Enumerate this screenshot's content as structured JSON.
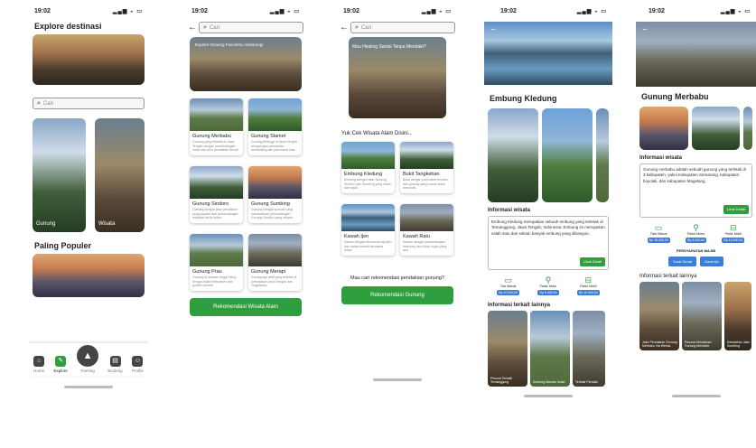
{
  "status": {
    "time": "19:02",
    "icons": "signal-wifi-battery"
  },
  "s1": {
    "title": "Explore destinasi",
    "search_placeholder": "Cari",
    "card1_label": "Gunung",
    "card2_label": "Wisata",
    "popular_title": "Paling Populer",
    "nav": [
      {
        "label": "Home",
        "icon": "home-icon"
      },
      {
        "label": "Explore",
        "icon": "explore-icon"
      },
      {
        "label": "Parking",
        "icon": "navigate-icon"
      },
      {
        "label": "Booking",
        "icon": "booking-icon"
      },
      {
        "label": "Profile",
        "icon": "profile-icon"
      }
    ]
  },
  "s2": {
    "search_placeholder": "Cari",
    "banner": "Explore Gunung Favoritmu Sekarang!",
    "cards": [
      {
        "name": "Gunung Merbabu",
        "desc": "Gunung yang terletak di Jawa Tengah dengan pemandangan indah dan jalur pendakian favorit."
      },
      {
        "name": "Gunung Slamet",
        "desc": "Gunung tertinggi di Jawa Tengah dengan jalur pendakian menantang dan panorama luas."
      },
      {
        "name": "Gunung Sindoro",
        "desc": "Gunung dengan jalur pendakian yang populer dan pemandangan matahari terbit indah."
      },
      {
        "name": "Gunung Sumbing",
        "desc": "Gunung dengan puncak yang menawarkan pemandangan Gunung Sindoro yang megah."
      },
      {
        "name": "Gunung Prau",
        "desc": "Gunung di dataran tinggi Dieng dengan bukit teletubbies dan golden sunrise."
      },
      {
        "name": "Gunung Merapi",
        "desc": "Gunung api aktif yang terletak di perbatasan Jawa Tengah dan Yogyakarta."
      }
    ],
    "button": "Rekomendasi Wisata Alam"
  },
  "s3": {
    "search_placeholder": "Cari",
    "banner": "Mau Healing Santai Tanpa Mendaki?",
    "section": "Yuk Cek Wisata Alam Disini...",
    "cards": [
      {
        "name": "Embung Kledung",
        "desc": "Embung dengan latar Gunung Sindoro dan Sumbing yang indah dan sejuk."
      },
      {
        "name": "Bukit Tangkeban",
        "desc": "Bukit dengan panorama lembah dan gunung yang cocok untuk bersantai."
      },
      {
        "name": "Kawah Ijen",
        "desc": "Kawah dengan fenomena api biru dan danau kawah berwarna toska."
      },
      {
        "name": "Kawah Ratu",
        "desc": "Kawah dengan pemandangan belerang dan hutan hujan yang asri."
      }
    ],
    "question": "Mau cari rekomendasi pendakian gunung?",
    "button": "Rekomendasi Gunung"
  },
  "s4": {
    "title": "Embung Kledung",
    "info_title": "Informasi wisata",
    "info_text": "Embung Kledung merupakan sebuah embung yang terletak di Temanggung, Jawa Tengah, Indonesia. Embung ini merupakan salah satu dari sekian banyak embung yang dibangun.",
    "detail_btn": "Lihat Detail",
    "transport": [
      {
        "label": "Taxi Masuk",
        "price": "Rp 10.000,00"
      },
      {
        "label": "Parkir Motor",
        "price": "Rp 5.000,00"
      },
      {
        "label": "Parkir Mobil",
        "price": "Rp 10.000,00"
      }
    ],
    "related_title": "Informasi terkait lainnya",
    "related": [
      "Pesona Terbaik Temanggung",
      "Embung Mandar Indah",
      "Terbaik Pendaki"
    ]
  },
  "s5": {
    "title": "Gunung Merbabu",
    "info_title": "Informasi wisata",
    "info_text": "Gunung merbabu adalah sebuah gunung yang terletak di 3 kabupaten, yakni Kabupaten Semarang, kabupaten boyolali, dan kabupaten Magelang.",
    "detail_btn": "Lihat Detail",
    "transport": [
      {
        "label": "Tiket Masuk",
        "price": "Rp 15.000,00"
      },
      {
        "label": "Parkir Motor",
        "price": "Rp 5.000,00"
      },
      {
        "label": "Parkir Mobil",
        "price": "Rp 10.000,00"
      }
    ],
    "route_title": "PERSYARATAN WAJIB",
    "route_buttons": [
      "Surat Sehat",
      "Surat Ijin"
    ],
    "related_title": "Informasi terkait lainnya",
    "related": [
      "Jalur Pendakian Gunung Merbabu Via Wekas",
      "Pesona Keindahan Gunung Merbabu",
      "Keindahan Jalur Sumbing"
    ]
  }
}
